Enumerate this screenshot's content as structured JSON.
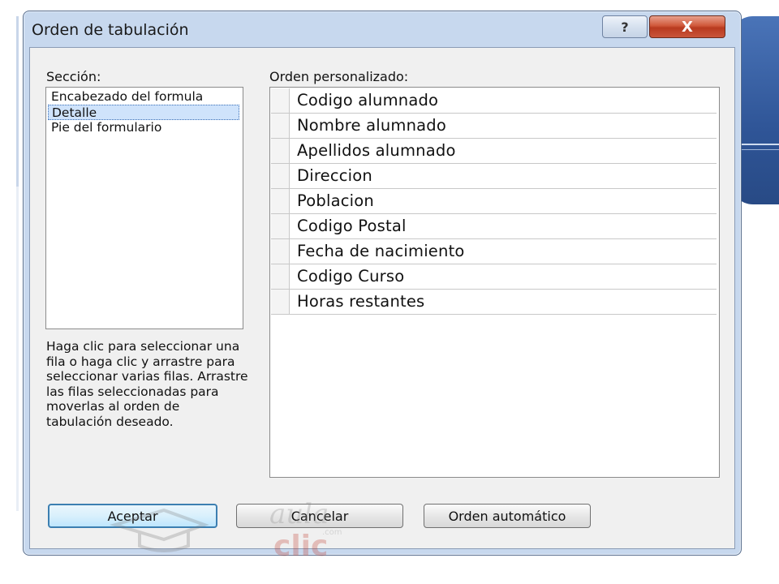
{
  "window": {
    "title": "Orden de tabulación",
    "help_glyph": "?",
    "close_glyph": "X"
  },
  "seccion": {
    "label": "Sección:",
    "items": [
      {
        "label": "Encabezado del formula",
        "selected": false
      },
      {
        "label": "Detalle",
        "selected": true
      },
      {
        "label": "Pie del formulario",
        "selected": false
      }
    ]
  },
  "orden": {
    "label": "Orden personalizado:",
    "rows": [
      "Codigo alumnado",
      "Nombre alumnado",
      "Apellidos alumnado",
      "Direccion",
      "Poblacion",
      "Codigo Postal",
      "Fecha de nacimiento",
      "Codigo Curso",
      "Horas restantes"
    ]
  },
  "help_text": "Haga clic para seleccionar una fila o haga clic y arrastre para seleccionar varias filas. Arrastre las filas seleccionadas para moverlas al orden de tabulación deseado.",
  "buttons": {
    "aceptar": "Aceptar",
    "cancelar": "Cancelar",
    "orden_automatico": "Orden automático"
  },
  "watermark": {
    "line1": "aula",
    "line2": "clic",
    "dot": ".com"
  },
  "colors": {
    "frame": "#c7d8ee",
    "close": "#c9553a",
    "selection": "#cfe3fb",
    "accent_tab": "#2f5597"
  }
}
